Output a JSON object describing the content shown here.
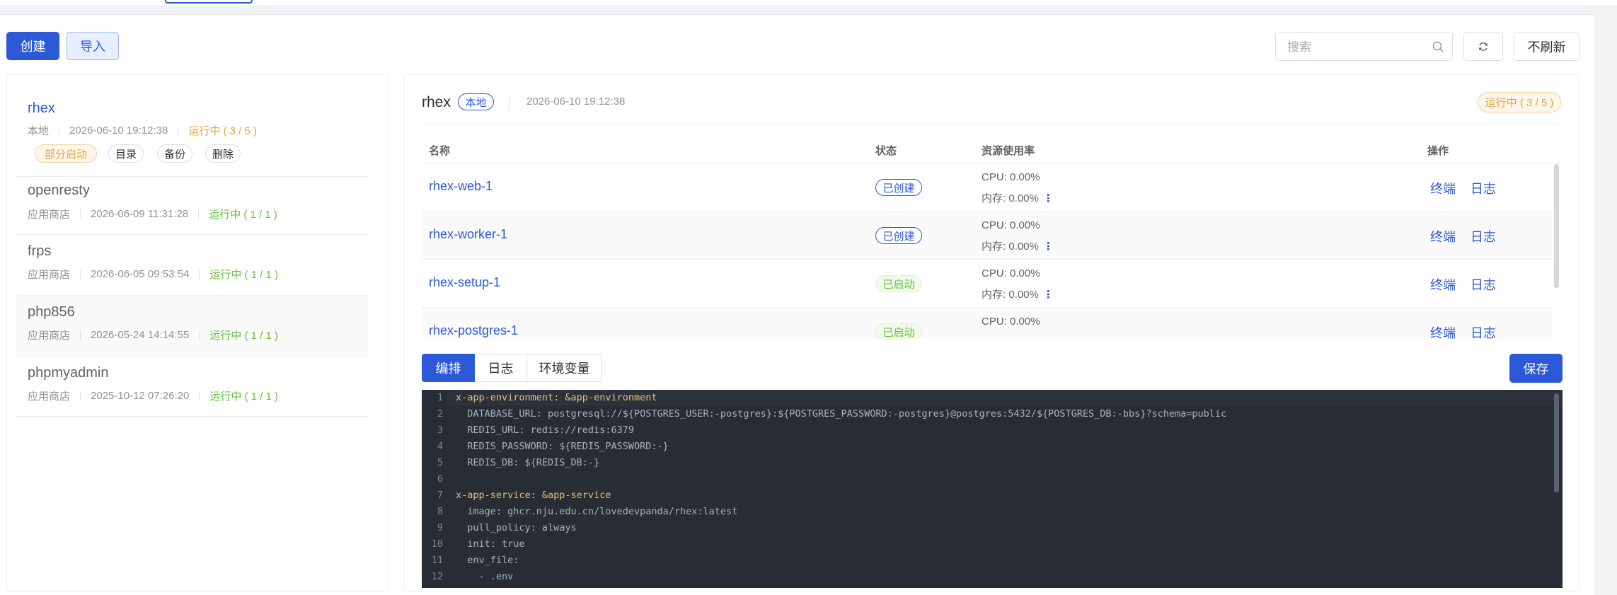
{
  "toolbar": {
    "create_label": "创建",
    "import_label": "导入",
    "search_placeholder": "搜索",
    "no_refresh_label": "不刷新"
  },
  "apps": [
    {
      "name": "rhex",
      "source": "本地",
      "time": "2026-06-10 19:12:38",
      "status": "运行中 ( 3 / 5 )",
      "actions": [
        "部分启动",
        "目录",
        "备份",
        "删除"
      ]
    },
    {
      "name": "openresty",
      "source": "应用商店",
      "time": "2026-06-09 11:31:28",
      "status": "运行中 ( 1 / 1 )"
    },
    {
      "name": "frps",
      "source": "应用商店",
      "time": "2026-06-05 09:53:54",
      "status": "运行中 ( 1 / 1 )"
    },
    {
      "name": "php856",
      "source": "应用商店",
      "time": "2026-05-24 14:14:55",
      "status": "运行中 ( 1 / 1 )"
    },
    {
      "name": "phpmyadmin",
      "source": "应用商店",
      "time": "2025-10-12 07:26:20",
      "status": "运行中 ( 1 / 1 )"
    }
  ],
  "detail": {
    "name": "rhex",
    "source_tag": "本地",
    "time": "2026-06-10 19:12:38",
    "status": "运行中 ( 3 / 5 )",
    "columns": [
      "名称",
      "状态",
      "资源使用率",
      "操作"
    ],
    "containers": [
      {
        "name": "rhex-web-1",
        "state": "已创建",
        "cpu": "CPU: 0.00%",
        "mem": "内存: 0.00%",
        "terminal": "终端",
        "log": "日志"
      },
      {
        "name": "rhex-worker-1",
        "state": "已创建",
        "cpu": "CPU: 0.00%",
        "mem": "内存: 0.00%",
        "terminal": "终端",
        "log": "日志"
      },
      {
        "name": "rhex-setup-1",
        "state": "已启动",
        "cpu": "CPU: 0.00%",
        "mem": "内存: 0.00%",
        "terminal": "终端",
        "log": "日志"
      },
      {
        "name": "rhex-postgres-1",
        "state": "已启动",
        "cpu": "CPU: 0.00%",
        "mem": "",
        "terminal": "终端",
        "log": "日志"
      }
    ],
    "tabs": [
      "编排",
      "日志",
      "环境变量"
    ],
    "save_label": "保存"
  },
  "editor": {
    "lines": [
      "x-app-environment: &app-environment",
      "  DATABASE_URL: postgresql://${POSTGRES_USER:-postgres}:${POSTGRES_PASSWORD:-postgres}@postgres:5432/${POSTGRES_DB:-bbs}?schema=public",
      "  REDIS_URL: redis://redis:6379",
      "  REDIS_PASSWORD: ${REDIS_PASSWORD:-}",
      "  REDIS_DB: ${REDIS_DB:-}",
      "",
      "x-app-service: &app-service",
      "  image: ghcr.nju.edu.cn/lovedevpanda/rhex:latest",
      "  pull_policy: always",
      "  init: true",
      "  env_file:",
      "    - .env"
    ]
  },
  "colors": {
    "accent": "#2b59d8",
    "running_orange": "#e6a23c",
    "running_green": "#67c23a",
    "editor_bg": "#282c34"
  }
}
